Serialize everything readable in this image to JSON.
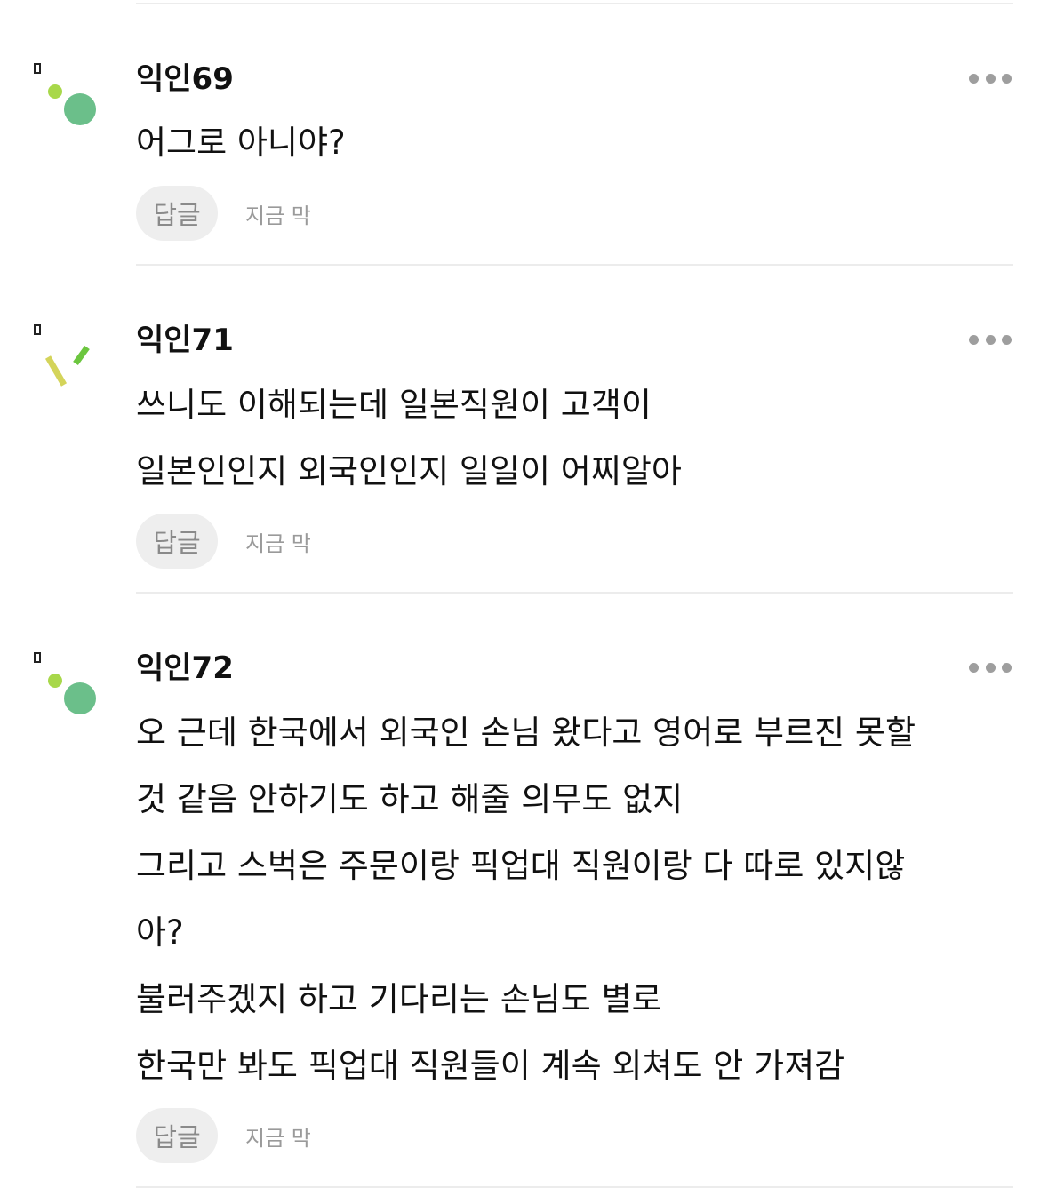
{
  "comments": [
    {
      "author": "익인69",
      "avatar_icon": "dots-avatar-icon",
      "lines": [
        "어그로 아니야?"
      ],
      "reply_label": "답글",
      "timestamp": "지금 막"
    },
    {
      "author": "익인71",
      "avatar_icon": "sticks-avatar-icon",
      "lines": [
        "쓰니도 이해되는데 일본직원이 고객이",
        "일본인인지 외국인인지 일일이 어찌알아"
      ],
      "reply_label": "답글",
      "timestamp": "지금 막"
    },
    {
      "author": "익인72",
      "avatar_icon": "dots-avatar-icon",
      "lines": [
        "오 근데 한국에서 외국인 손님 왔다고 영어로 부르진 못할",
        "것 같음 안하기도 하고 해줄 의무도 없지",
        "그리고 스벅은 주문이랑 픽업대 직원이랑 다 따로 있지않",
        "아?",
        "불러주겠지 하고 기다리는 손님도 별로",
        "한국만 봐도 픽업대 직원들이 계속 외쳐도 안 가져감"
      ],
      "reply_label": "답글",
      "timestamp": "지금 막"
    }
  ],
  "colors": {
    "accent_green": "#6bbf8a",
    "accent_lime": "#a8d84a",
    "accent_yellow": "#d4d45a",
    "accent_bright_green": "#6cc63f"
  }
}
